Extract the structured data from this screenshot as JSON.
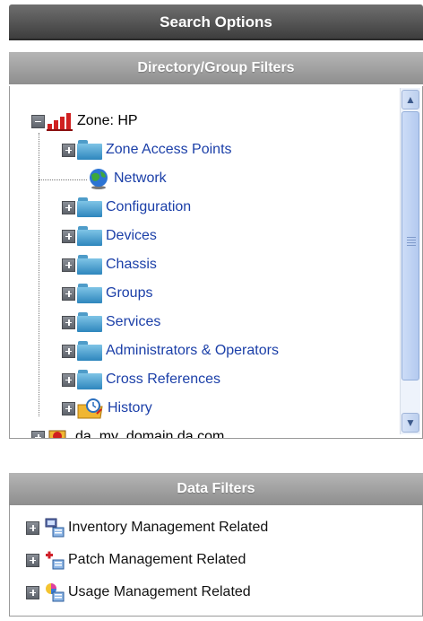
{
  "header": {
    "title": "Search Options"
  },
  "directory_panel": {
    "title": "Directory/Group Filters",
    "root": {
      "label": "Zone: HP",
      "icon": "zone-icon",
      "expanded": true
    },
    "children": [
      {
        "label": "Zone Access Points",
        "icon": "folder-icon",
        "expandable": true
      },
      {
        "label": "Network",
        "icon": "globe-icon",
        "expandable": false
      },
      {
        "label": "Configuration",
        "icon": "folder-icon",
        "expandable": true
      },
      {
        "label": "Devices",
        "icon": "folder-icon",
        "expandable": true
      },
      {
        "label": "Chassis",
        "icon": "folder-icon",
        "expandable": true
      },
      {
        "label": "Groups",
        "icon": "folder-icon",
        "expandable": true
      },
      {
        "label": "Services",
        "icon": "folder-icon",
        "expandable": true
      },
      {
        "label": "Administrators & Operators",
        "icon": "folder-icon",
        "expandable": true
      },
      {
        "label": "Cross References",
        "icon": "folder-icon",
        "expandable": true
      },
      {
        "label": "History",
        "icon": "history-icon",
        "expandable": true
      }
    ],
    "next_root": {
      "label": "da_my_domain da.com",
      "icon": "domain-icon"
    }
  },
  "data_panel": {
    "title": "Data Filters",
    "items": [
      {
        "label": "Inventory Management Related",
        "icon": "inventory-icon"
      },
      {
        "label": "Patch Management Related",
        "icon": "patch-icon"
      },
      {
        "label": "Usage Management Related",
        "icon": "usage-icon"
      }
    ]
  }
}
